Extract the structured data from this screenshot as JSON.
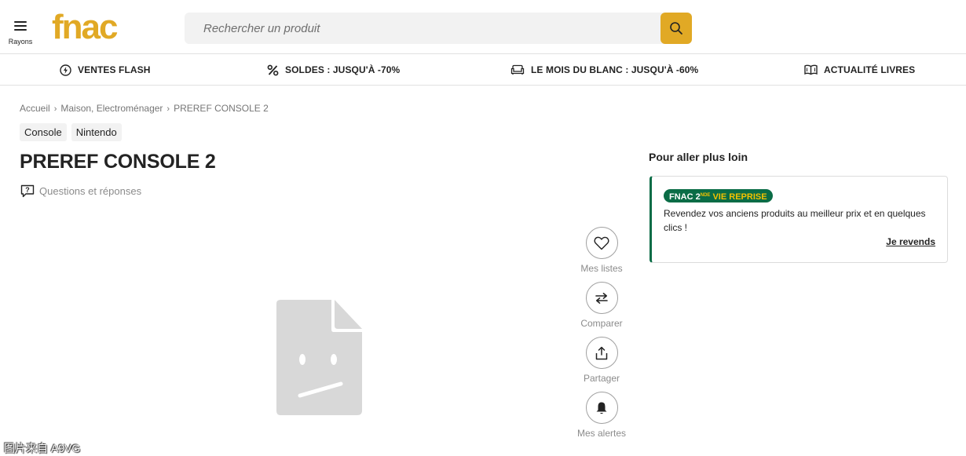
{
  "header": {
    "menu_label": "Rayons",
    "logo_text": "fnac",
    "search_placeholder": "Rechercher un produit"
  },
  "promo_nav": [
    {
      "icon": "flash-icon",
      "label": "VENTES FLASH"
    },
    {
      "icon": "percent-icon",
      "label": "SOLDES : JUSQU'À -70%"
    },
    {
      "icon": "sofa-icon",
      "label": "LE MOIS DU BLANC : JUSQU'À -60%"
    },
    {
      "icon": "book-icon",
      "label": "ACTUALITÉ LIVRES"
    }
  ],
  "breadcrumb": [
    "Accueil",
    "Maison, Electroménager",
    "PREREF CONSOLE 2"
  ],
  "tags": [
    "Console",
    "Nintendo"
  ],
  "product": {
    "title": "PREREF CONSOLE 2",
    "qa_label": "Questions et réponses"
  },
  "actions": [
    {
      "icon": "heart-icon",
      "label": "Mes listes"
    },
    {
      "icon": "compare-icon",
      "label": "Comparer"
    },
    {
      "icon": "share-icon",
      "label": "Partager"
    },
    {
      "icon": "bell-icon",
      "label": "Mes alertes"
    }
  ],
  "aside": {
    "title": "Pour aller plus loin",
    "badge_brand": "FNAC 2",
    "badge_sup": "NDE",
    "badge_rest": "VIE REPRISE",
    "text": "Revendez vos anciens produits au meilleur prix et en quelques clics !",
    "link": "Je revends"
  },
  "watermark": "图片来自 A9VG",
  "colors": {
    "brand_yellow": "#e1a925",
    "reprise_green": "#0a6c46",
    "text_dark": "#232323",
    "text_muted": "#8b8b8b"
  }
}
